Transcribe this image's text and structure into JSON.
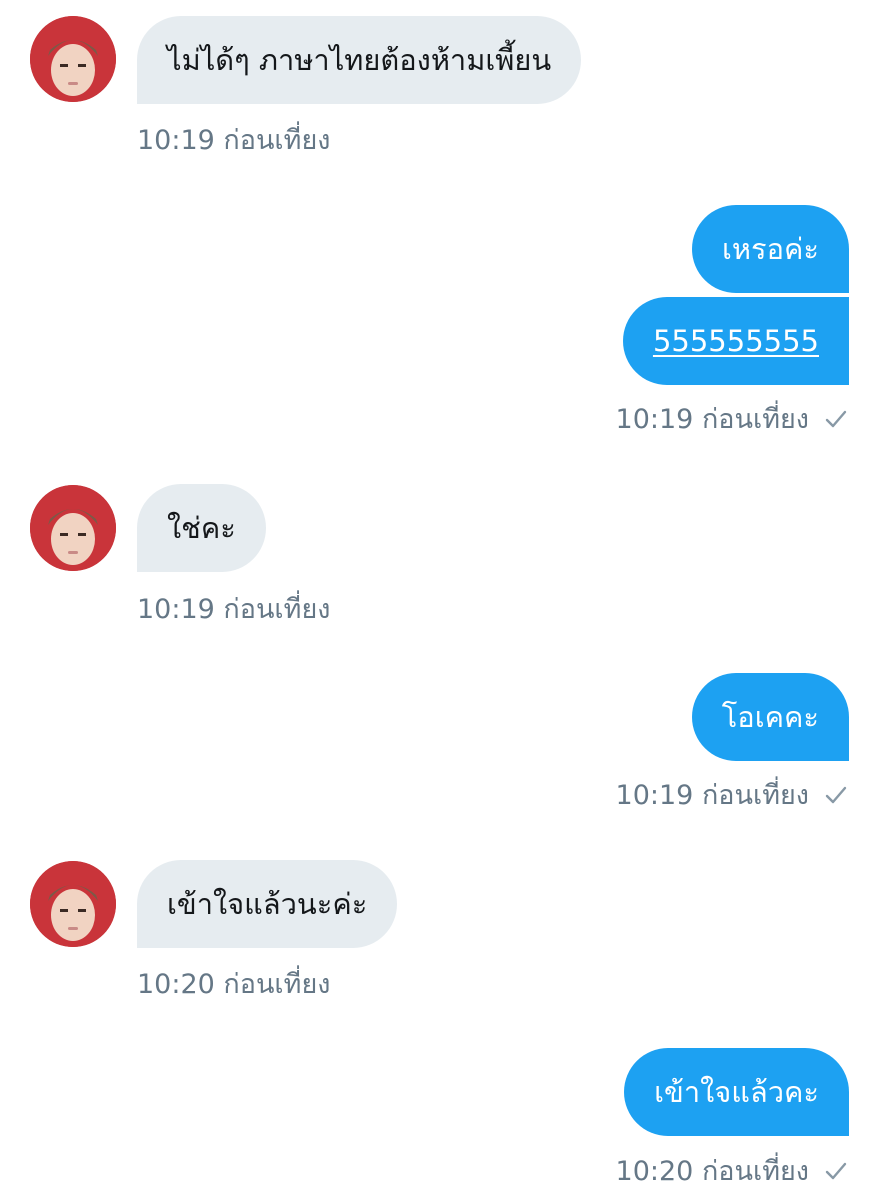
{
  "colors": {
    "incoming_bubble": "#e6ecf0",
    "outgoing_bubble": "#1da1f2",
    "timestamp": "#657786"
  },
  "messages": [
    {
      "direction": "incoming",
      "text": "ไม่ได้ๆ ภาษาไทยต้องห้ามเพี้ยน",
      "time": "10:19 ก่อนเที่ยง"
    },
    {
      "direction": "outgoing",
      "texts": [
        "เหรอค่ะ",
        "555555555"
      ],
      "time": "10:19 ก่อนเที่ยง",
      "status_icon": "check-icon"
    },
    {
      "direction": "incoming",
      "text": "ใช่คะ",
      "time": "10:19 ก่อนเที่ยง"
    },
    {
      "direction": "outgoing",
      "texts": [
        "โอเคคะ"
      ],
      "time": "10:19 ก่อนเที่ยง",
      "status_icon": "check-icon"
    },
    {
      "direction": "incoming",
      "text": "เข้าใจแล้วนะค่ะ",
      "time": "10:20 ก่อนเที่ยง"
    },
    {
      "direction": "outgoing",
      "texts": [
        "เข้าใจแล้วคะ"
      ],
      "time": "10:20 ก่อนเที่ยง",
      "status_icon": "check-icon"
    }
  ]
}
